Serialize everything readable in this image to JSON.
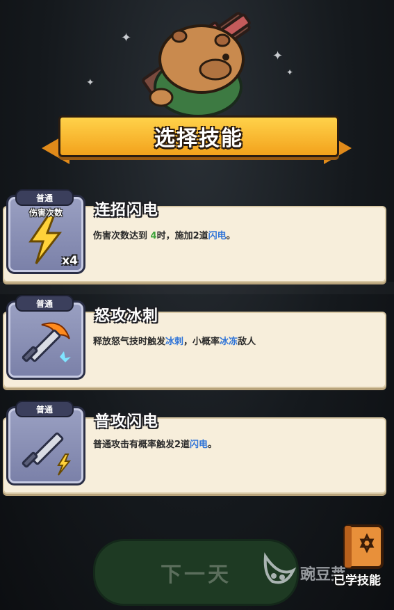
{
  "header": {
    "title": "选择技能"
  },
  "skills": [
    {
      "tier": "普通",
      "icon_caption": "伤害次数",
      "icon_multiplier": "x4",
      "icon": "lightning-icon",
      "name": "连招闪电",
      "desc_1": "伤害次数达到 ",
      "desc_hl1": "4",
      "desc_2": "时，施加2道",
      "desc_hl2": "闪电",
      "desc_3": "。"
    },
    {
      "tier": "普通",
      "icon": "flaming-sword-icon",
      "name": "怒攻冰刺",
      "desc_1": "释放怒气技时触发",
      "desc_hl1": "冰刺",
      "desc_2": "，小概率",
      "desc_hl2": "冰冻",
      "desc_3": "敌人"
    },
    {
      "tier": "普通",
      "icon": "sword-lightning-icon",
      "name": "普攻闪电",
      "desc_1": "普通攻击有概率触发2道",
      "desc_hl1": "闪电",
      "desc_3": "。"
    }
  ],
  "footer": {
    "next_day_label": "下一天",
    "learned_skills_label": "已学技能",
    "watermark_text": "豌豆荚"
  },
  "colors": {
    "banner": "#f3a21c",
    "highlight_green": "#3da33a",
    "highlight_blue": "#2f74d8",
    "card_bg": "#f7eedb"
  }
}
